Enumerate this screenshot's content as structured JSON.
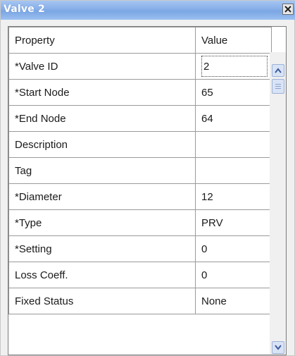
{
  "window": {
    "title": "Valve 2"
  },
  "grid": {
    "headers": {
      "property": "Property",
      "value": "Value"
    },
    "rows": [
      {
        "property": "*Valve ID",
        "value": "2"
      },
      {
        "property": "*Start Node",
        "value": "65"
      },
      {
        "property": "*End Node",
        "value": "64"
      },
      {
        "property": "Description",
        "value": ""
      },
      {
        "property": "Tag",
        "value": ""
      },
      {
        "property": "*Diameter",
        "value": "12"
      },
      {
        "property": "*Type",
        "value": "PRV"
      },
      {
        "property": "*Setting",
        "value": "0"
      },
      {
        "property": "Loss Coeff.",
        "value": "0"
      },
      {
        "property": "Fixed Status",
        "value": "None"
      }
    ]
  },
  "icons": {
    "close": "close-icon",
    "scroll_up": "scroll-up-arrow-icon",
    "scroll_down": "scroll-down-arrow-icon"
  },
  "colors": {
    "titlebar": "#86aee8",
    "title_text": "#ffffff",
    "grid_line": "#9a9a9a",
    "background": "#f0f0f0"
  }
}
